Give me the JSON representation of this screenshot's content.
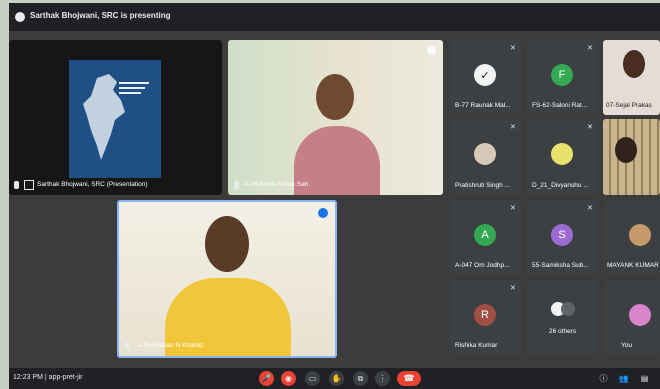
{
  "header": {
    "presenting_text": "Sarthak Bhojwani, SRC is presenting"
  },
  "main": {
    "presentation_label": "Sarthak Bhojwani, SRC (Presentation)",
    "neha_label": "A-08-Neha Ashok Sah",
    "raman_label": "A-55-Raman N Khatod"
  },
  "grid": {
    "raunak": {
      "label": "B-77 Raunak Mal..."
    },
    "saloni": {
      "label": "FS-62-Saloni Rat...",
      "initial": "F"
    },
    "sejal": {
      "label": "07-Sejal Prakas"
    },
    "pratishruti": {
      "label": "Pratishruti Singh ..."
    },
    "divyanshu": {
      "label": "D_21_Divyanshu ..."
    },
    "om": {
      "label": "A-047 Om Jodhp...",
      "initial": "A"
    },
    "samiksha": {
      "label": "55-Samiksha Sub...",
      "initial": "S"
    },
    "mayank": {
      "label": "MAYANK KUMAR"
    },
    "rishika": {
      "label": "Rishika Kumar",
      "initial": "R"
    },
    "others": {
      "label": "26 others"
    },
    "you": {
      "label": "You"
    }
  },
  "footer": {
    "time_meeting": "12:23 PM  |  app-pret-jir"
  },
  "colors": {
    "green_avatar": "#34a853",
    "purple_avatar": "#9b6ad3",
    "red_avatar": "#a14f45",
    "hangup": "#ea4335"
  }
}
